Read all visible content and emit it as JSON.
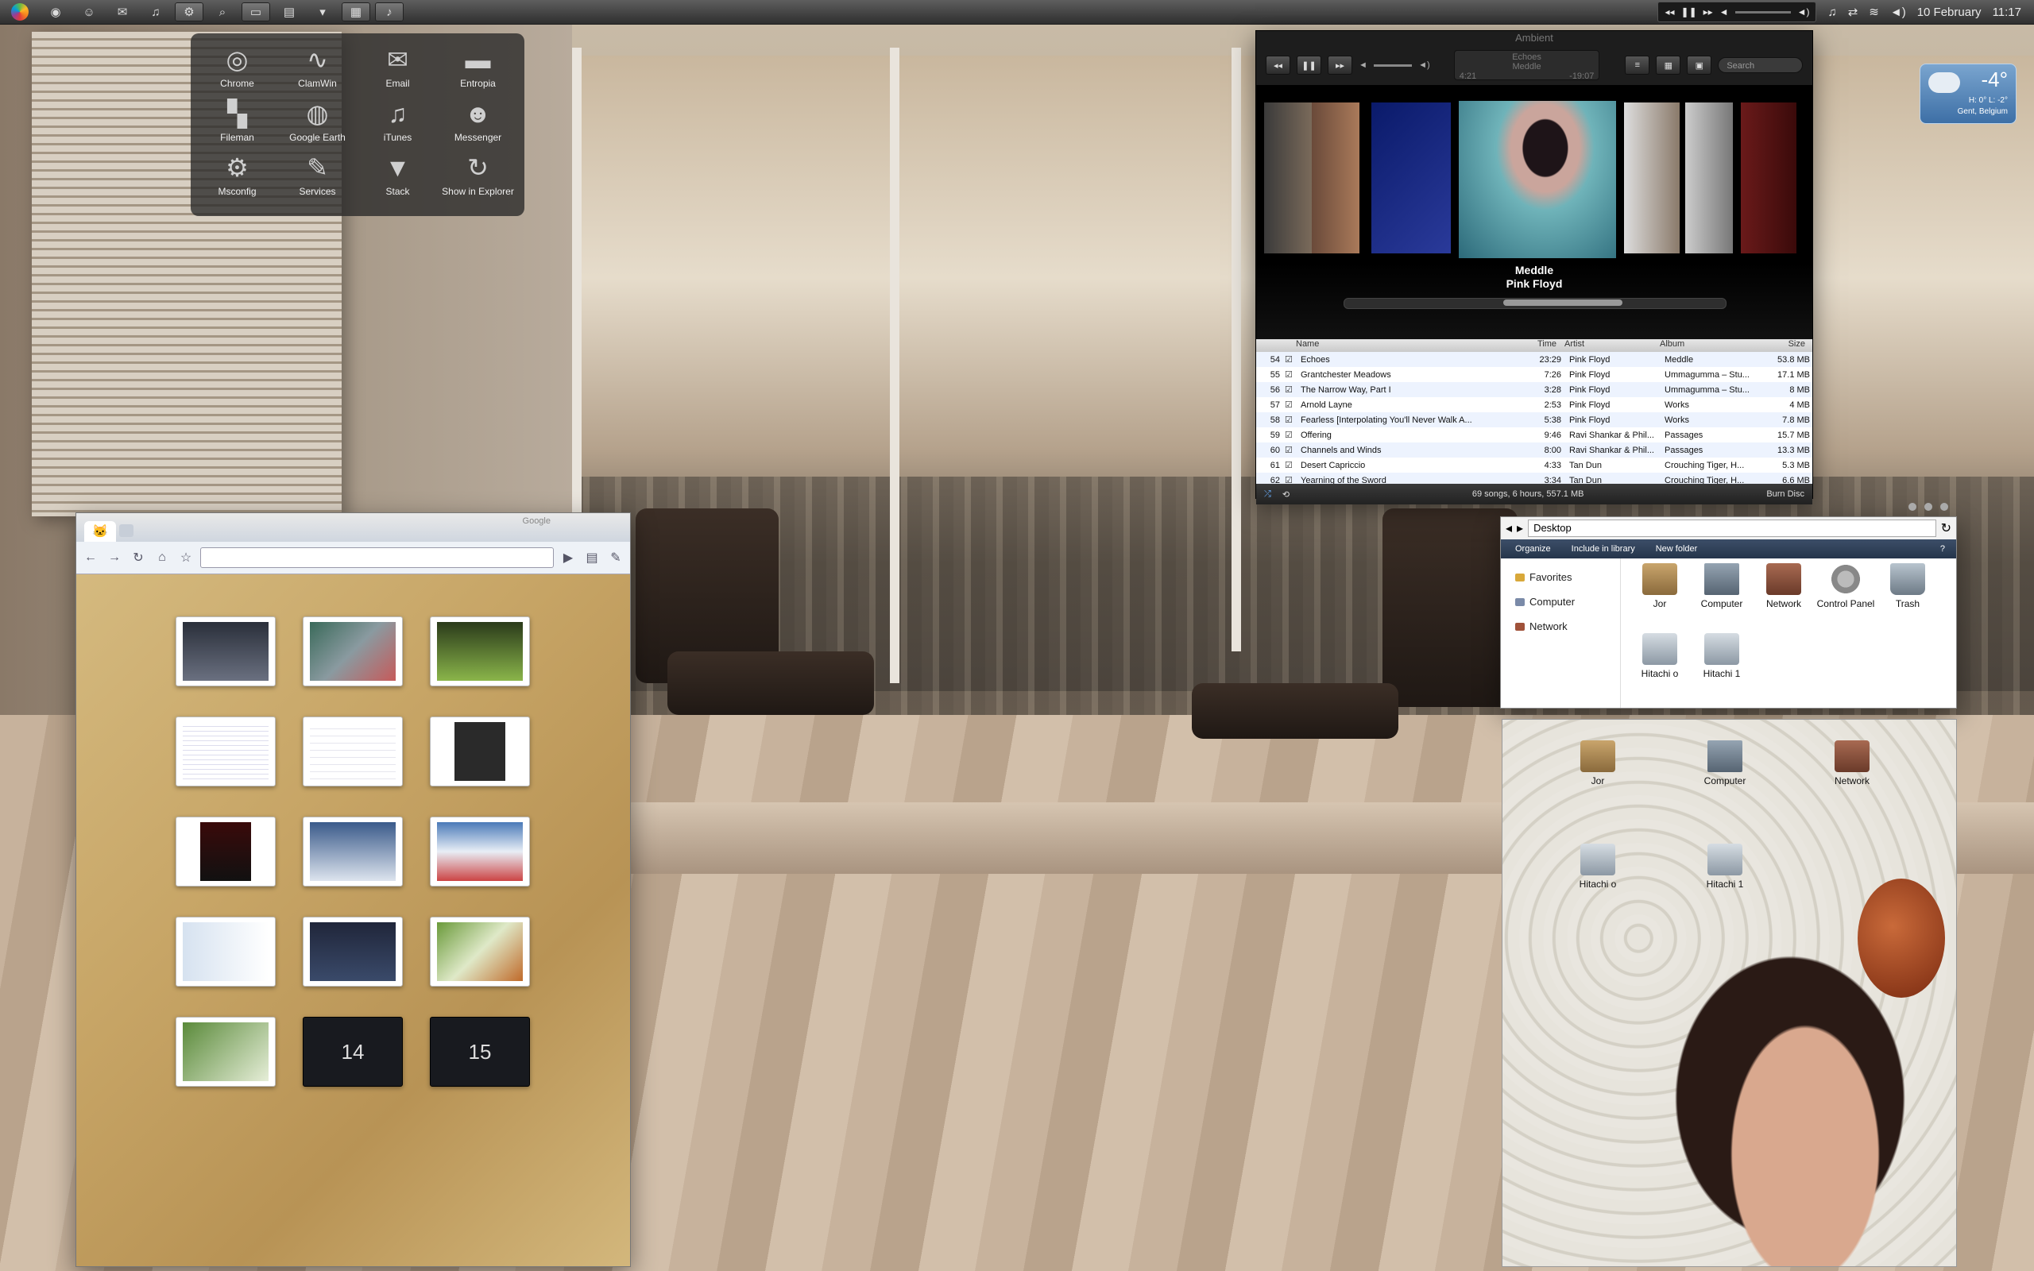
{
  "menubar": {
    "clock_date": "10 February",
    "clock_time": "11:17",
    "icons": [
      "apple-logo",
      "chrome-icon",
      "messenger-icon",
      "email-icon",
      "itunes-icon",
      "settings-icon",
      "search-icon",
      "folder-icon",
      "explorer-icon",
      "stack-icon",
      "window-icon",
      "music-icon"
    ]
  },
  "launcher": {
    "items": [
      {
        "label": "Chrome",
        "icon": "chrome-icon"
      },
      {
        "label": "ClamWin",
        "icon": "pulse-icon"
      },
      {
        "label": "Email",
        "icon": "envelope-icon"
      },
      {
        "label": "Entropia",
        "icon": "folder-icon"
      },
      {
        "label": "Fileman",
        "icon": "fileman-icon"
      },
      {
        "label": "Google Earth",
        "icon": "globe-icon"
      },
      {
        "label": "iTunes",
        "icon": "music-note-icon"
      },
      {
        "label": "Messenger",
        "icon": "people-icon"
      },
      {
        "label": "Msconfig",
        "icon": "gear-icon"
      },
      {
        "label": "Services",
        "icon": "wrench-icon"
      },
      {
        "label": "Stack",
        "icon": "triangle-icon"
      },
      {
        "label": "Show in Explorer",
        "icon": "arrow-circle-icon"
      }
    ]
  },
  "itunes": {
    "title": "Ambient",
    "lcd_line1": "Echoes",
    "lcd_line2": "Meddle",
    "lcd_elapsed": "4:21",
    "lcd_remaining": "-19:07",
    "search_placeholder": "Search",
    "now_album": "Meddle",
    "now_artist": "Pink Floyd",
    "columns": {
      "name": "Name",
      "time": "Time",
      "artist": "Artist",
      "album": "Album",
      "size": "Size"
    },
    "tracks": [
      {
        "num": "54",
        "name": "Echoes",
        "time": "23:29",
        "artist": "Pink Floyd",
        "album": "Meddle",
        "size": "53.8 MB"
      },
      {
        "num": "55",
        "name": "Grantchester Meadows",
        "time": "7:26",
        "artist": "Pink Floyd",
        "album": "Ummagumma – Stu...",
        "size": "17.1 MB"
      },
      {
        "num": "56",
        "name": "The Narrow Way, Part I",
        "time": "3:28",
        "artist": "Pink Floyd",
        "album": "Ummagumma – Stu...",
        "size": "8 MB"
      },
      {
        "num": "57",
        "name": "Arnold Layne",
        "time": "2:53",
        "artist": "Pink Floyd",
        "album": "Works",
        "size": "4 MB"
      },
      {
        "num": "58",
        "name": "Fearless [Interpolating You'll Never Walk A...",
        "time": "5:38",
        "artist": "Pink Floyd",
        "album": "Works",
        "size": "7.8 MB"
      },
      {
        "num": "59",
        "name": "Offering",
        "time": "9:46",
        "artist": "Ravi Shankar & Phil...",
        "album": "Passages",
        "size": "15.7 MB"
      },
      {
        "num": "60",
        "name": "Channels and Winds",
        "time": "8:00",
        "artist": "Ravi Shankar & Phil...",
        "album": "Passages",
        "size": "13.3 MB"
      },
      {
        "num": "61",
        "name": "Desert Capriccio",
        "time": "4:33",
        "artist": "Tan Dun",
        "album": "Crouching Tiger, H...",
        "size": "5.3 MB"
      },
      {
        "num": "62",
        "name": "Yearning of the Sword",
        "time": "3:34",
        "artist": "Tan Dun",
        "album": "Crouching Tiger, H...",
        "size": "6.6 MB"
      }
    ],
    "status_summary": "69 songs, 6 hours, 557.1 MB",
    "burn_label": "Burn Disc"
  },
  "weather": {
    "temp": "-4°",
    "range": "H: 0° L: -2°",
    "location": "Gent, Belgium"
  },
  "chrome": {
    "google_label": "Google",
    "thumbnail_numbers": [
      "14",
      "15"
    ]
  },
  "explorer": {
    "path": "Desktop",
    "commands": [
      "Organize",
      "Include in library",
      "New folder"
    ],
    "nav": [
      "Favorites",
      "Computer",
      "Network"
    ],
    "items": [
      "Jor",
      "Computer",
      "Network",
      "Control Panel",
      "Trash",
      "Hitachi o",
      "Hitachi 1"
    ]
  },
  "desktop": {
    "icons": [
      "Jor",
      "Computer",
      "Network",
      "Hitachi o",
      "Hitachi 1"
    ]
  }
}
